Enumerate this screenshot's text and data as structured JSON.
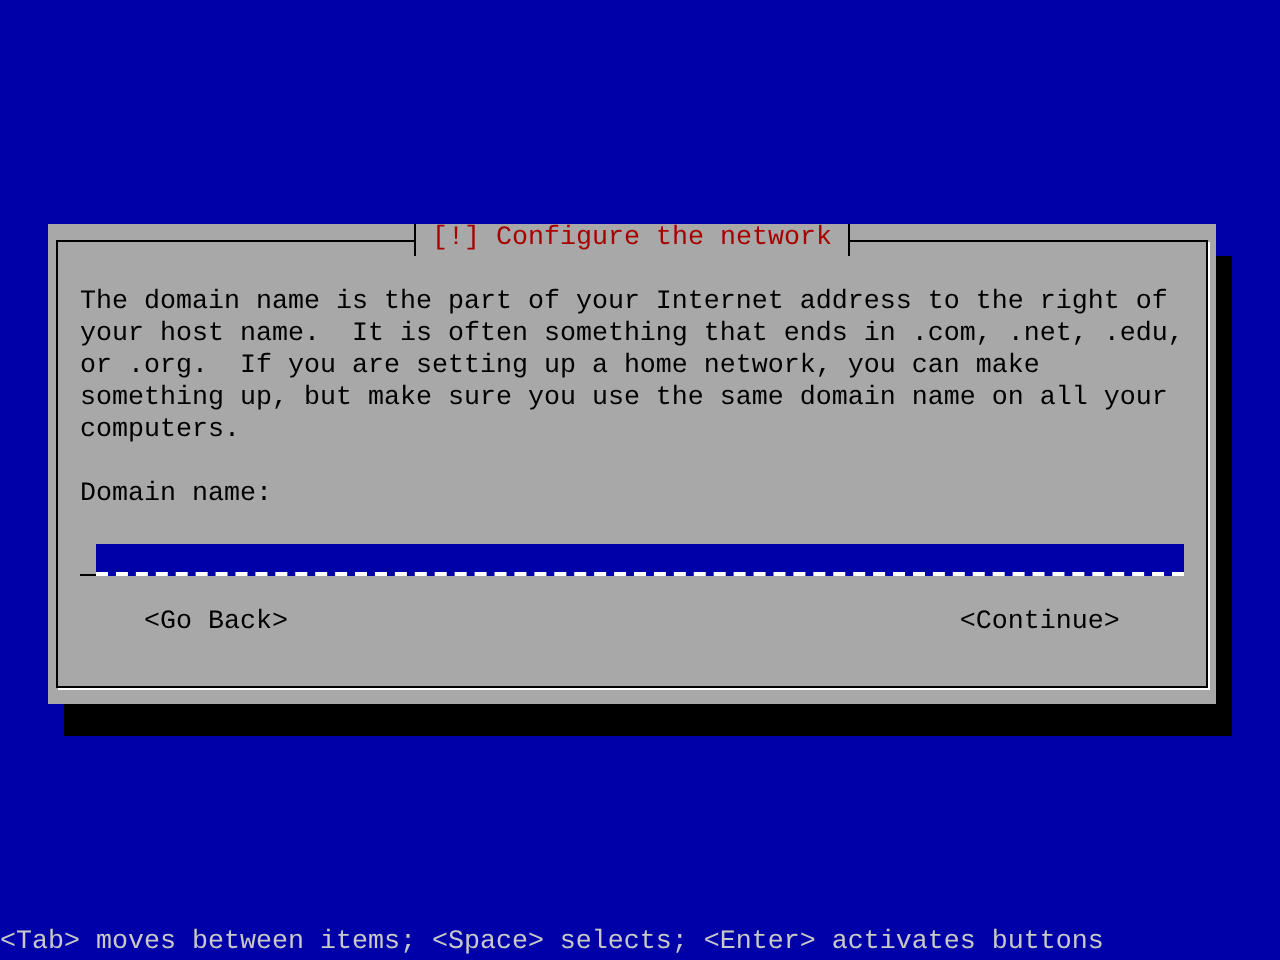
{
  "dialog": {
    "title": "[!] Configure the network",
    "message": "The domain name is the part of your Internet address to the right of your host name.  It is often something that ends in .com, .net, .edu, or .org.  If you are setting up a home network, you can make something up, but make sure you use the same domain name on all your computers.",
    "field": {
      "label": "Domain name:",
      "focused": true
    },
    "buttons": [
      {
        "label": "<Go Back>",
        "focused": false
      },
      {
        "label": "<Continue>",
        "focused": false
      }
    ]
  },
  "status_bar": "<Tab> moves between items; <Space> selects; <Enter> activates buttons"
}
